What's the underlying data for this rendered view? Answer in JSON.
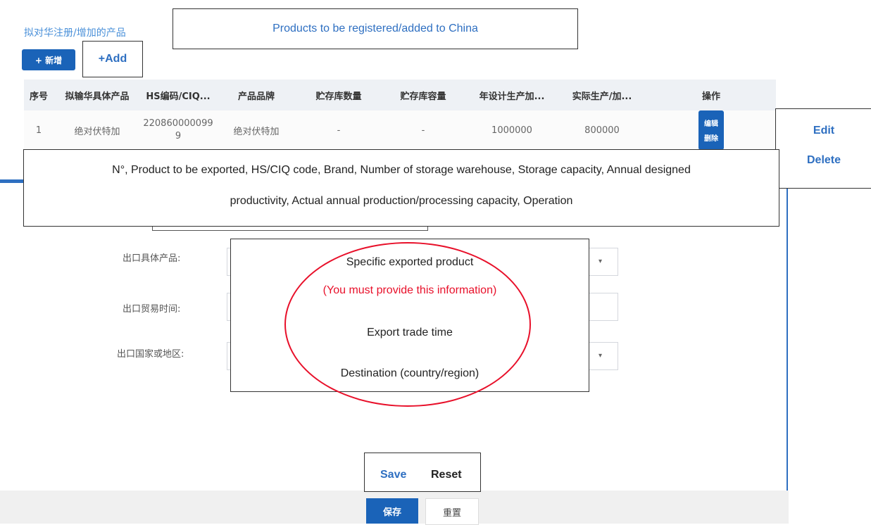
{
  "section": {
    "title": "拟对华注册/增加的产品",
    "new_button": "+ 新增"
  },
  "table": {
    "headers": [
      "序号",
      "拟输华具体产品",
      "HS编码/CIQ...",
      "产品品牌",
      "贮存库数量",
      "贮存库容量",
      "年设计生产加...",
      "实际生产/加...",
      "操作"
    ],
    "rows": [
      {
        "no": "1",
        "product": "绝对伏特加",
        "hs_code": "2208600000999",
        "brand": "绝对伏特加",
        "storage_count": "-",
        "storage_capacity": "-",
        "design_capacity": "1000000",
        "actual_capacity": "800000",
        "edit": "编辑",
        "delete": "删除"
      }
    ]
  },
  "form": {
    "product_label": "出口具体产品:",
    "time_label": "出口贸易时间:",
    "country_label": "出口国家或地区:"
  },
  "footer": {
    "save": "保存",
    "reset": "重置"
  },
  "annotations": {
    "products_title": "Products to be registered/added to China",
    "add": "+Add",
    "edit": "Edit",
    "delete": "Delete",
    "columns_line1": "N°, Product to be exported, HS/CIQ code, Brand, Number of storage warehouse, Storage capacity, Annual designed",
    "columns_line2": "productivity, Actual annual production/processing capacity, Operation",
    "specific_product": "Specific exported product",
    "must_provide": "(You must provide this information)",
    "trade_time": "Export trade time",
    "destination": "Destination (country/region)",
    "save": "Save",
    "reset": "Reset"
  },
  "colors": {
    "primary": "#1a63b8",
    "annotation_blue": "#2e6fc1",
    "warning_red": "#e8102a"
  }
}
